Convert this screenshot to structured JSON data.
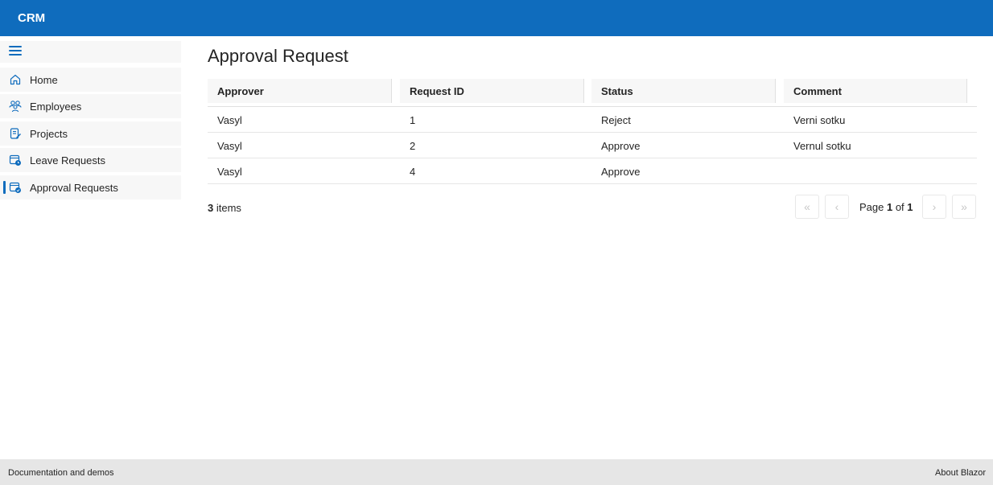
{
  "app": {
    "title": "CRM"
  },
  "sidebar": {
    "items": [
      {
        "label": "Home",
        "icon": "home-icon"
      },
      {
        "label": "Employees",
        "icon": "people-icon"
      },
      {
        "label": "Projects",
        "icon": "clipboard-icon"
      },
      {
        "label": "Leave Requests",
        "icon": "calendar-clock-icon"
      },
      {
        "label": "Approval Requests",
        "icon": "calendar-check-icon"
      }
    ],
    "active_index": 4
  },
  "main": {
    "title": "Approval Request",
    "columns": [
      "Approver",
      "Request ID",
      "Status",
      "Comment"
    ],
    "rows": [
      {
        "approver": "Vasyl",
        "request_id": "1",
        "status": "Reject",
        "comment": "Verni sotku"
      },
      {
        "approver": "Vasyl",
        "request_id": "2",
        "status": "Approve",
        "comment": "Vernul sotku"
      },
      {
        "approver": "Vasyl",
        "request_id": "4",
        "status": "Approve",
        "comment": ""
      }
    ],
    "pager": {
      "items_count": "3",
      "items_label": " items",
      "page_prefix": "Page ",
      "current_page": "1",
      "of_label": " of ",
      "total_pages": "1"
    }
  },
  "footer": {
    "left_link": "Documentation and demos",
    "right_link": "About Blazor"
  },
  "colors": {
    "accent": "#0f6cbd",
    "footer_bg": "#e6e6e6",
    "header_cell_bg": "#f7f7f7"
  }
}
